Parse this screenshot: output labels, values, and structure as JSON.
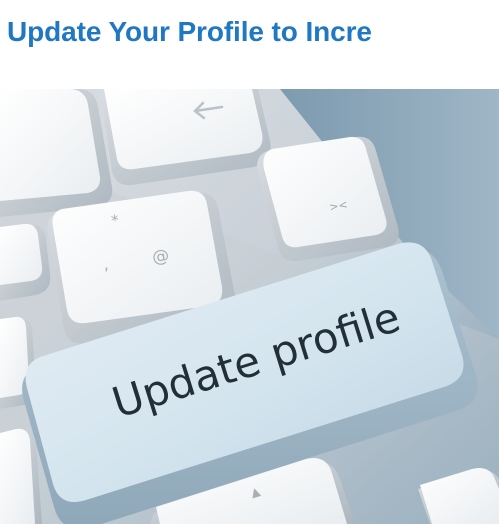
{
  "article": {
    "headline": "Update Your Profile to Incre"
  },
  "image": {
    "description_icon": "keyboard-photo",
    "key_label": "Update profile",
    "key_glyphs": {
      "asterisk": "*",
      "at": "@",
      "comma": ","
    }
  },
  "colors": {
    "headline": "#1f78c1",
    "background_top_right": "#8fa8ba",
    "key_face": "#f4f6f7",
    "highlight_key": "#d6e6f0",
    "key_text": "#1b2730"
  }
}
